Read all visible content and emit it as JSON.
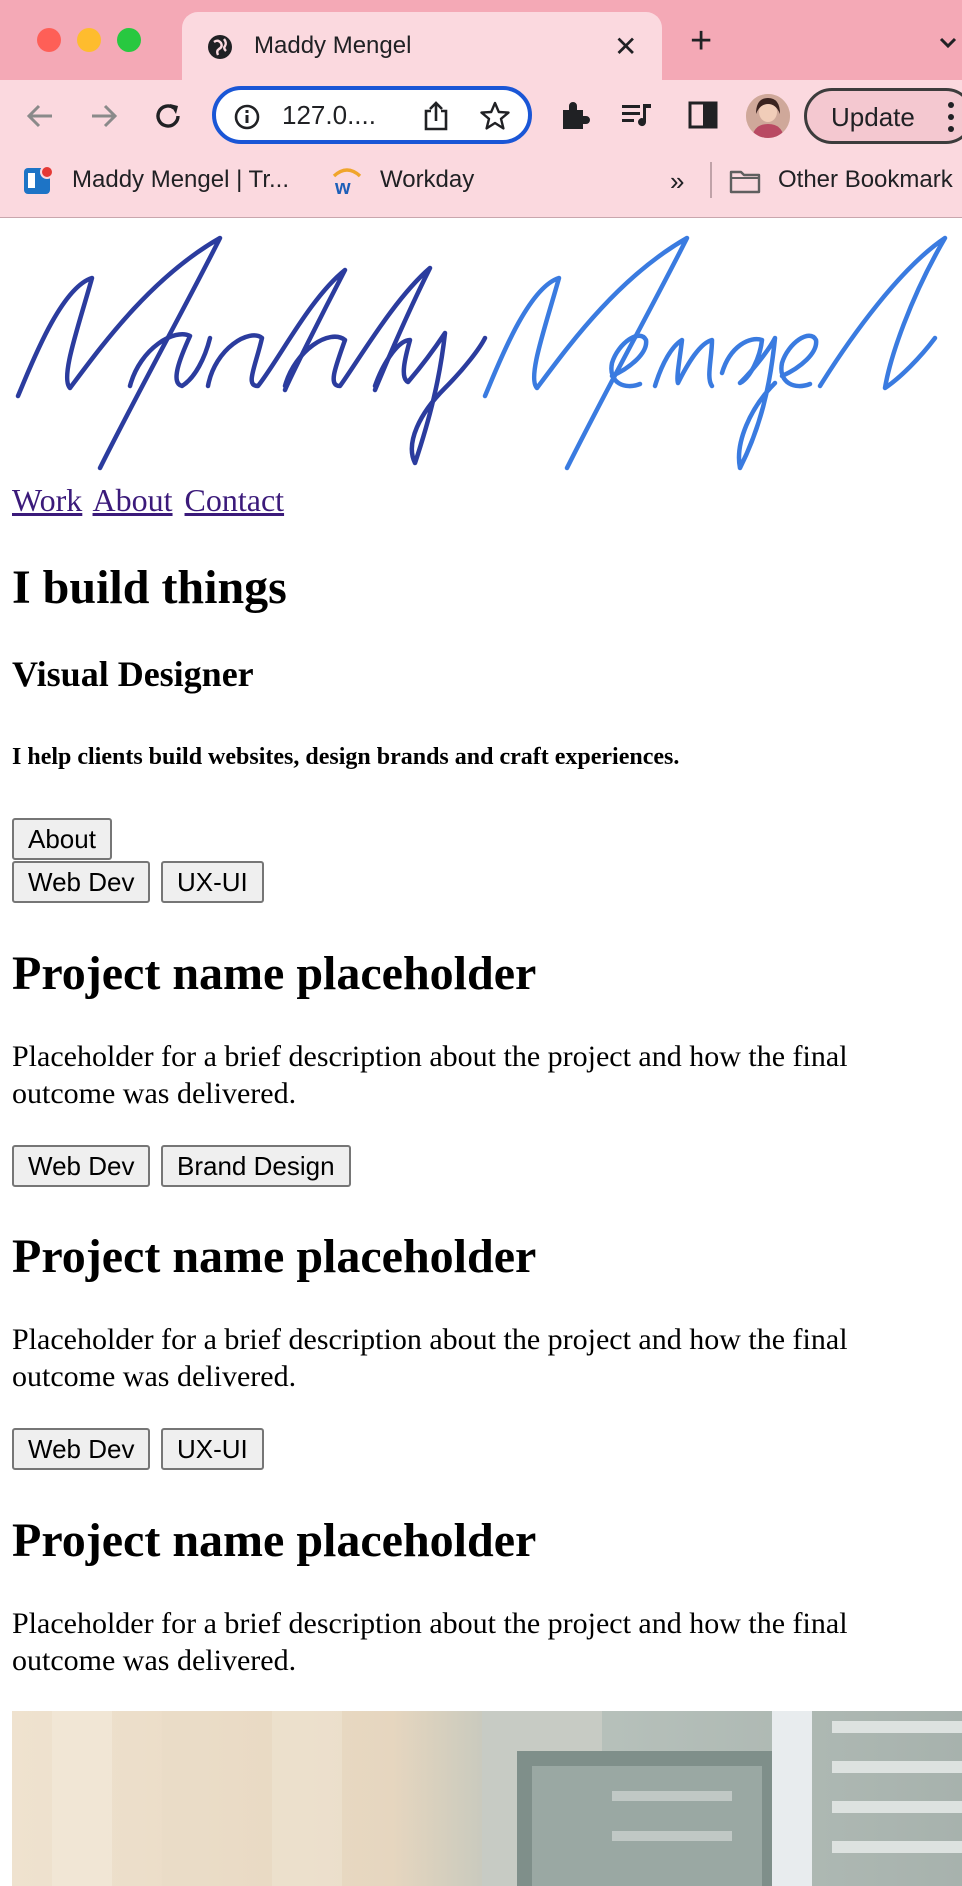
{
  "browser": {
    "tab_title": "Maddy Mengel",
    "tab_close": "✕",
    "new_tab": "+",
    "url": "127.0....",
    "update_label": "Update",
    "bookmarks": [
      {
        "label": "Maddy Mengel | Tr..."
      },
      {
        "label": "Workday"
      }
    ],
    "bookmarks_overflow": "»",
    "other_bookmarks": "Other Bookmark"
  },
  "site": {
    "logo_text": "Maddy Mengel",
    "logo_colors": {
      "first": "#2b3c9e",
      "last": "#3a7be0"
    },
    "nav": {
      "work": "Work",
      "about": "About",
      "contact": "Contact"
    },
    "hero": {
      "heading": "I build things",
      "role": "Visual Designer",
      "tagline": "I help clients build websites, design brands and craft experiences.",
      "about_button": "About"
    },
    "filters": [
      "Web Dev",
      "UX-UI"
    ],
    "projects": [
      {
        "title": "Project name placeholder",
        "description": "Placeholder for a brief description about the project and how the final outcome was delivered.",
        "tags": [
          "Web Dev",
          "Brand Design"
        ]
      },
      {
        "title": "Project name placeholder",
        "description": "Placeholder for a brief description about the project and how the final outcome was delivered.",
        "tags": [
          "Web Dev",
          "UX-UI"
        ]
      },
      {
        "title": "Project name placeholder",
        "description": "Placeholder for a brief description about the project and how the final outcome was delivered."
      }
    ]
  }
}
